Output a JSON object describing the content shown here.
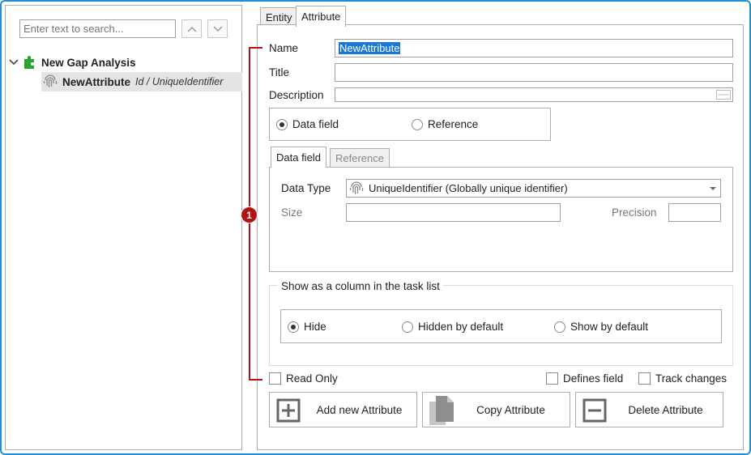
{
  "search": {
    "placeholder": "Enter text to search..."
  },
  "tree": {
    "root_label": "New Gap Analysis",
    "child": {
      "name": "NewAttribute",
      "type": "Id / UniqueIdentifier"
    }
  },
  "tabs": {
    "entity": "Entity",
    "attribute": "Attribute"
  },
  "form": {
    "name_label": "Name",
    "name_value": "NewAttribute",
    "title_label": "Title",
    "title_value": "",
    "description_label": "Description",
    "description_value": "",
    "source": {
      "data_field": "Data field",
      "reference": "Reference",
      "selected": "Data field"
    },
    "subtabs": {
      "data_field": "Data field",
      "reference": "Reference"
    },
    "data_type_label": "Data Type",
    "data_type_value": "UniqueIdentifier (Globally unique identifier)",
    "size_label": "Size",
    "size_value": "",
    "precision_label": "Precision",
    "precision_value": "",
    "column_group_title": "Show as a column in the task list",
    "column_options": {
      "hide": "Hide",
      "hidden_by_default": "Hidden by default",
      "show_by_default": "Show by default",
      "selected": "Hide"
    },
    "read_only": "Read Only",
    "defines_field": "Defines field",
    "track_changes": "Track changes"
  },
  "actions": {
    "add": "Add new Attribute",
    "copy": "Copy Attribute",
    "delete": "Delete Attribute"
  },
  "callout": {
    "number": "1",
    "color": "#b11414"
  },
  "colors": {
    "frame": "#1e8fd8",
    "selection": "#1a78d6",
    "puzzle": "#2aa52a"
  }
}
